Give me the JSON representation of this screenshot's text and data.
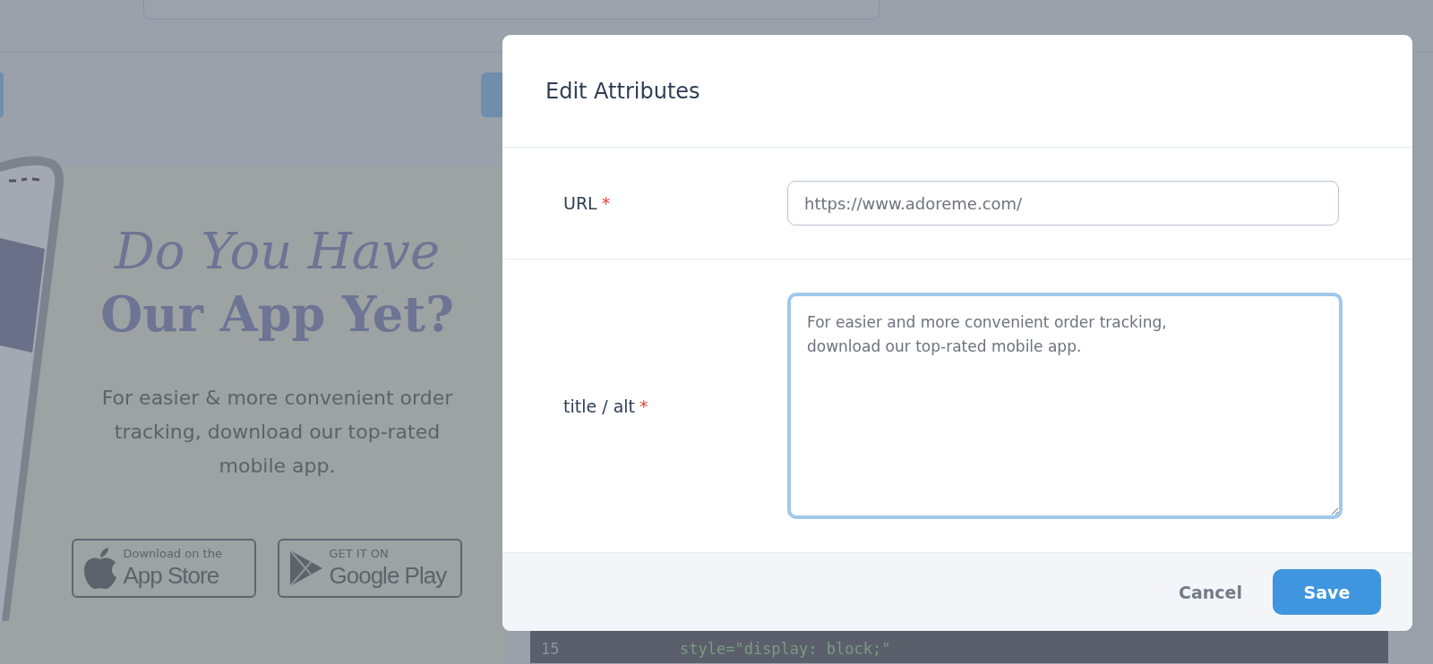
{
  "banner": {
    "heading_italic": "Do You Have",
    "heading_bold": "Our App Yet?",
    "text": "For easier & more convenient order tracking, download our top-rated mobile app.",
    "badges": [
      {
        "kind": "apple",
        "small": "Download on the",
        "big": "App Store"
      },
      {
        "kind": "google",
        "small": "GET IT ON",
        "big": "Google Play"
      }
    ]
  },
  "code": {
    "lines": [
      {
        "number": "15",
        "code": "style=\"display: block;\""
      }
    ]
  },
  "dialog": {
    "title": "Edit Attributes",
    "fields": [
      {
        "kind": "input",
        "label": "URL",
        "required_mark": "*",
        "value": "https://www.adoreme.com/",
        "focused": false
      },
      {
        "kind": "textarea",
        "label": "title / alt",
        "required_mark": "*",
        "value": "For easier and more convenient order tracking,\ndownload our top-rated mobile app.",
        "focused": true
      }
    ],
    "buttons": [
      {
        "kind": "text",
        "label": "Cancel"
      },
      {
        "kind": "primary",
        "label": "Save"
      }
    ]
  }
}
